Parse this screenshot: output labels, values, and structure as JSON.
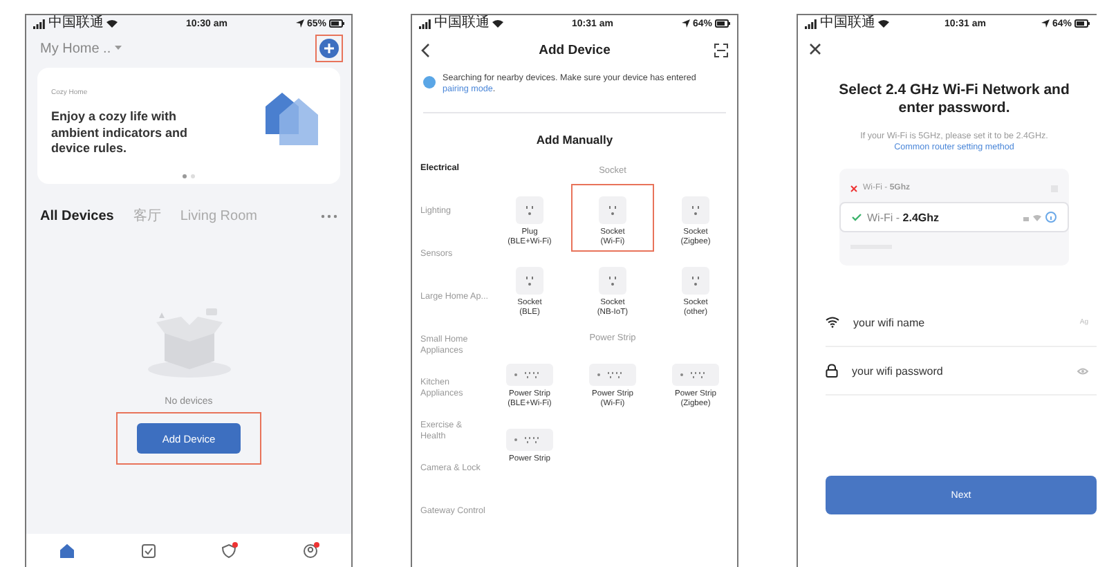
{
  "phones": [
    {
      "kind": "home",
      "status": {
        "carrier": "中国联通",
        "time": "10:30 am",
        "battery": "65%"
      },
      "home_title": "My Home ..",
      "add_highlighted": true,
      "banner": {
        "label": "Cozy Home",
        "text": "Enjoy a cozy life with ambient indicators and device rules."
      },
      "rooms": [
        {
          "label": "All Devices",
          "selected": true
        },
        {
          "label": "客厅",
          "selected": false
        },
        {
          "label": "Living Room",
          "selected": false
        }
      ],
      "empty_text": "No devices",
      "add_button": {
        "label": "Add Device",
        "highlighted": true
      },
      "tabs": [
        {
          "kind": "home",
          "selected": true,
          "badge": false
        },
        {
          "kind": "scene",
          "selected": false,
          "badge": false
        },
        {
          "kind": "smart",
          "selected": false,
          "badge": true
        },
        {
          "kind": "me",
          "selected": false,
          "badge": true
        }
      ]
    },
    {
      "kind": "add",
      "status": {
        "carrier": "中国联通",
        "time": "10:31 am",
        "battery": "64%"
      },
      "title": "Add Device",
      "notice": {
        "text": "Searching for nearby devices. Make sure your device has entered",
        "link": "pairing mode",
        "end": "."
      },
      "section_title": "Add Manually",
      "categories": [
        {
          "label": "Electrical",
          "selected": true
        },
        {
          "label": "Lighting",
          "selected": false
        },
        {
          "label": "Sensors",
          "selected": false
        },
        {
          "label": "Large Home Ap...",
          "selected": false
        },
        {
          "label": "Small Home Appliances",
          "selected": false
        },
        {
          "label": "Kitchen Appliances",
          "selected": false
        },
        {
          "label": "Exercise & Health",
          "selected": false
        },
        {
          "label": "Camera & Lock",
          "selected": false
        },
        {
          "label": "Gateway Control",
          "selected": false
        }
      ],
      "groups": [
        {
          "title": "Socket",
          "items": [
            {
              "kind": "socket",
              "name": "Plug",
              "sub": "(BLE+Wi-Fi)",
              "highlighted": false
            },
            {
              "kind": "socket",
              "name": "Socket",
              "sub": "(Wi-Fi)",
              "highlighted": true
            },
            {
              "kind": "socket",
              "name": "Socket",
              "sub": "(Zigbee)",
              "highlighted": false
            },
            {
              "kind": "socket",
              "name": "Socket",
              "sub": "(BLE)",
              "highlighted": false
            },
            {
              "kind": "socket",
              "name": "Socket",
              "sub": "(NB-IoT)",
              "highlighted": false
            },
            {
              "kind": "socket",
              "name": "Socket",
              "sub": "(other)",
              "highlighted": false
            }
          ]
        },
        {
          "title": "Power Strip",
          "items": [
            {
              "kind": "strip",
              "name": "Power Strip",
              "sub": "(BLE+Wi-Fi)",
              "highlighted": false
            },
            {
              "kind": "strip",
              "name": "Power Strip",
              "sub": "(Wi-Fi)",
              "highlighted": false
            },
            {
              "kind": "strip",
              "name": "Power Strip",
              "sub": "(Zigbee)",
              "highlighted": false
            },
            {
              "kind": "strip",
              "name": "Power Strip",
              "highlighted": false
            }
          ]
        }
      ]
    },
    {
      "kind": "wifi",
      "status": {
        "carrier": "中国联通",
        "time": "10:31 am",
        "battery": "64%"
      },
      "title": "Select 2.4 GHz Wi-Fi Network and enter password.",
      "hint": "If your Wi-Fi is 5GHz, please set it to be 2.4GHz.",
      "link": "Common router setting method",
      "networks": [
        {
          "prefix": "Wi-Fi - ",
          "band": "5Ghz",
          "ok": false
        },
        {
          "prefix": "Wi-Fi - ",
          "band": "2.4Ghz",
          "ok": true
        }
      ],
      "fields": [
        {
          "kind": "name",
          "placeholder": "your wifi name",
          "hint": "Ag"
        },
        {
          "kind": "password",
          "placeholder": "your wifi password"
        }
      ],
      "button": "Next"
    }
  ]
}
